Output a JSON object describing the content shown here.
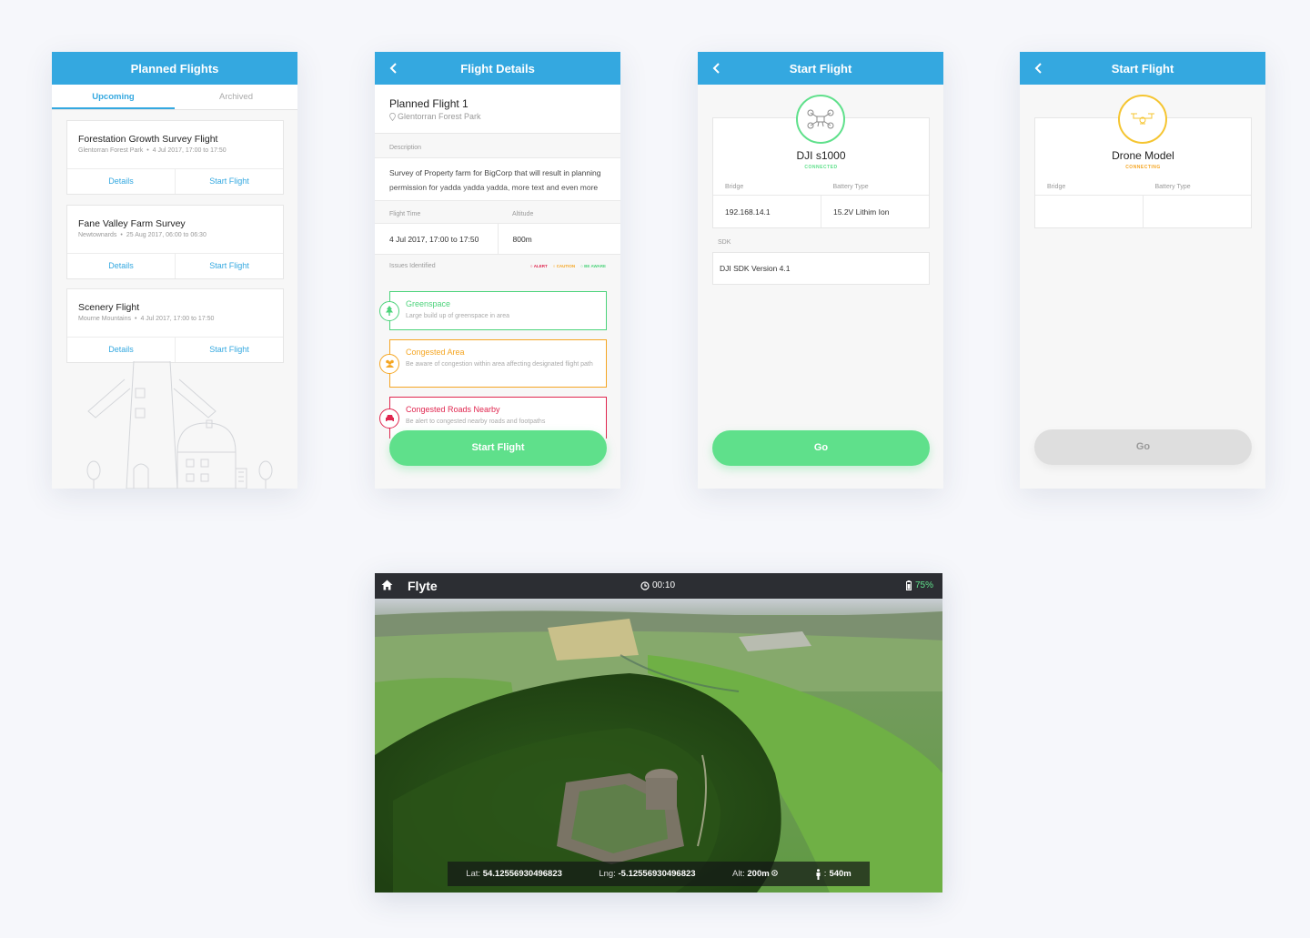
{
  "screen1": {
    "title": "Planned Flights",
    "tabs": [
      "Upcoming",
      "Archived"
    ],
    "flights": [
      {
        "title": "Forestation Growth Survey Flight",
        "location": "Glentorran Forest Park",
        "time": "4 Jul 2017, 17:00 to 17:50"
      },
      {
        "title": "Fane Valley Farm Survey",
        "location": "Newtownards",
        "time": "25 Aug 2017, 06:00 to 06:30"
      },
      {
        "title": "Scenery Flight",
        "location": "Mourne Mountains",
        "time": "4 Jul 2017, 17:00 to 17:50"
      }
    ],
    "details_label": "Details",
    "start_label": "Start Flight",
    "separator": "•"
  },
  "screen2": {
    "title": "Flight Details",
    "flight_name": "Planned Flight 1",
    "location": "Glentorran Forest Park",
    "description_label": "Description",
    "description": "Survey of Property farm for BigCorp that will result in planning permission for yadda yadda yadda, more text and even more text, someone stop me",
    "flight_time_label": "Flight Time",
    "altitude_label": "Altitude",
    "flight_time": "4 Jul 2017, 17:00 to 17:50",
    "altitude": "800m",
    "issues_label": "Issues Identified",
    "legend": {
      "alert": "ALERT",
      "caution": "CAUTION",
      "aware": "BE AWARE"
    },
    "issues": [
      {
        "title": "Greenspace",
        "text": "Large build up of greenspace in area",
        "color": "#4cd37b"
      },
      {
        "title": "Congested Area",
        "text": "Be aware of congestion within area affecting designated flight path",
        "color": "#f5a623"
      },
      {
        "title": "Congested Roads Nearby",
        "text": "Be alert to congested nearby roads and footpaths",
        "color": "#e0264f"
      }
    ],
    "start_button": "Start Flight"
  },
  "screen3": {
    "title": "Start Flight",
    "drone_name": "DJI s1000",
    "status": "CONNECTED",
    "bridge_label": "Bridge",
    "battery_label": "Battery Type",
    "bridge": "192.168.14.1",
    "battery": "15.2V Lithim Ion",
    "sdk_label": "SDK",
    "sdk": "DJI SDK Version 4.1",
    "go_button": "Go"
  },
  "screen4": {
    "title": "Start Flight",
    "drone_name": "Drone Model",
    "status": "CONNECTING",
    "bridge_label": "Bridge",
    "battery_label": "Battery Type",
    "go_button": "Go"
  },
  "video": {
    "brand": "Flyte",
    "timer": "00:10",
    "battery": "75%",
    "lat_label": "Lat:",
    "lat": "54.12556930496823",
    "lng_label": "Lng:",
    "lng": "-5.12556930496823",
    "alt_label": "Alt:",
    "alt": "200m",
    "dist": "540m"
  },
  "colors": {
    "primary": "#34a8e0",
    "green": "#5fe08b",
    "orange": "#f5a623",
    "red": "#e0264f"
  }
}
